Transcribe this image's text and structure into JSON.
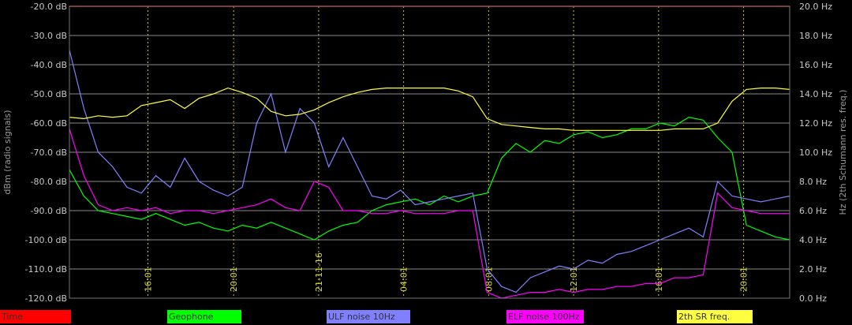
{
  "chart_data": {
    "type": "line",
    "title": "",
    "ylabel_left": "dBm (radio signals)",
    "ylabel_right": "Hz (2th Schumann res. freq.)",
    "ylim_left": [
      -120,
      -20
    ],
    "ylim_right": [
      0,
      20
    ],
    "grid": true,
    "legend_position": "bottom",
    "y_ticks_left": [
      "-20.0 dB",
      "-30.0 dB",
      "-40.0 dB",
      "-50.0 dB",
      "-60.0 dB",
      "-70.0 dB",
      "-80.0 dB",
      "-90.0 dB",
      "-100.0 dB",
      "-110.0 dB",
      "-120.0 dB"
    ],
    "y_ticks_right": [
      "20.0 Hz",
      "18.0 Hz",
      "16.0 Hz",
      "14.0 Hz",
      "12.0 Hz",
      "10.0 Hz",
      "8.0 Hz",
      "6.0 Hz",
      "4.0 Hz",
      "2.0 Hz",
      "0.0 Hz"
    ],
    "x_ticks": [
      "16:01",
      "20:01",
      "21-11-16",
      "04:01",
      "08:01",
      "12:01",
      "16:01",
      "20:01"
    ],
    "x_index_range": [
      0,
      100
    ],
    "x_tick_positions": [
      10.9,
      22.8,
      34.6,
      46.4,
      58.2,
      70.0,
      81.8,
      93.6
    ],
    "series": [
      {
        "name": "Geophone",
        "color": "#00ff00",
        "axis": "left",
        "x": [
          0,
          2,
          4,
          6,
          8,
          10,
          12,
          14,
          16,
          18,
          20,
          22,
          24,
          26,
          28,
          30,
          32,
          34,
          36,
          38,
          40,
          42,
          44,
          46,
          48,
          50,
          52,
          54,
          56,
          58,
          60,
          62,
          64,
          66,
          68,
          70,
          72,
          74,
          76,
          78,
          80,
          82,
          84,
          86,
          88,
          90,
          92,
          94,
          96,
          98,
          100
        ],
        "y": [
          -76,
          -85,
          -90,
          -91,
          -92,
          -93,
          -91,
          -93,
          -95,
          -94,
          -96,
          -97,
          -95,
          -96,
          -94,
          -96,
          -98,
          -100,
          -97,
          -95,
          -94,
          -90,
          -88,
          -87,
          -86,
          -88,
          -85,
          -87,
          -85,
          -84,
          -72,
          -67,
          -70,
          -66,
          -67,
          -64,
          -63,
          -65,
          -64,
          -62,
          -62,
          -60,
          -61,
          -58,
          -59,
          -65,
          -70,
          -95,
          -97,
          -99,
          -100
        ]
      },
      {
        "name": "ULF noise 10Hz",
        "color": "#8080ff",
        "axis": "left",
        "x": [
          0,
          2,
          4,
          6,
          8,
          10,
          12,
          14,
          16,
          18,
          20,
          22,
          24,
          26,
          28,
          30,
          32,
          34,
          36,
          38,
          40,
          42,
          44,
          46,
          48,
          50,
          52,
          54,
          56,
          58,
          60,
          62,
          64,
          66,
          68,
          70,
          72,
          74,
          76,
          78,
          80,
          82,
          84,
          86,
          88,
          90,
          92,
          94,
          96,
          98,
          100
        ],
        "y": [
          -35,
          -55,
          -70,
          -75,
          -82,
          -84,
          -78,
          -82,
          -72,
          -80,
          -83,
          -85,
          -82,
          -60,
          -50,
          -70,
          -55,
          -60,
          -75,
          -65,
          -75,
          -85,
          -86,
          -83,
          -88,
          -87,
          -86,
          -85,
          -84,
          -110,
          -116,
          -118,
          -113,
          -111,
          -109,
          -110,
          -107,
          -108,
          -105,
          -104,
          -102,
          -100,
          -98,
          -96,
          -99,
          -80,
          -85,
          -86,
          -87,
          -86,
          -85
        ]
      },
      {
        "name": "ELF noise 100Hz",
        "color": "#ff00ff",
        "axis": "left",
        "x": [
          0,
          2,
          4,
          6,
          8,
          10,
          12,
          14,
          16,
          18,
          20,
          22,
          24,
          26,
          28,
          30,
          32,
          34,
          36,
          38,
          40,
          42,
          44,
          46,
          48,
          50,
          52,
          54,
          56,
          58,
          60,
          62,
          64,
          66,
          68,
          70,
          72,
          74,
          76,
          78,
          80,
          82,
          84,
          86,
          88,
          90,
          92,
          94,
          96,
          98,
          100
        ],
        "y": [
          -62,
          -78,
          -88,
          -90,
          -89,
          -90,
          -89,
          -91,
          -90,
          -90,
          -91,
          -90,
          -89,
          -88,
          -86,
          -89,
          -90,
          -80,
          -82,
          -90,
          -90,
          -91,
          -91,
          -90,
          -91,
          -91,
          -91,
          -90,
          -90,
          -118,
          -120,
          -119,
          -118,
          -118,
          -117,
          -118,
          -117,
          -117,
          -116,
          -116,
          -115,
          -115,
          -113,
          -113,
          -112,
          -84,
          -89,
          -90,
          -91,
          -91,
          -91
        ]
      },
      {
        "name": "2th SR freq.",
        "color": "#ffff40",
        "axis": "right",
        "x": [
          0,
          2,
          4,
          6,
          8,
          10,
          12,
          14,
          16,
          18,
          20,
          22,
          24,
          26,
          28,
          30,
          32,
          34,
          36,
          38,
          40,
          42,
          44,
          46,
          48,
          50,
          52,
          54,
          56,
          58,
          60,
          62,
          64,
          66,
          68,
          70,
          72,
          74,
          76,
          78,
          80,
          82,
          84,
          86,
          88,
          90,
          92,
          94,
          96,
          98,
          100
        ],
        "y": [
          12.4,
          12.3,
          12.5,
          12.4,
          12.5,
          13.2,
          13.4,
          13.6,
          13.0,
          13.7,
          14.0,
          14.4,
          14.1,
          13.7,
          12.8,
          12.5,
          12.6,
          12.9,
          13.4,
          13.8,
          14.1,
          14.3,
          14.4,
          14.4,
          14.4,
          14.4,
          14.4,
          14.2,
          13.8,
          12.3,
          11.9,
          11.8,
          11.7,
          11.6,
          11.6,
          11.5,
          11.5,
          11.5,
          11.5,
          11.5,
          11.5,
          11.5,
          11.6,
          11.6,
          11.6,
          12.0,
          13.5,
          14.3,
          14.4,
          14.4,
          14.3
        ]
      },
      {
        "name": "Time",
        "color": "#ff0000",
        "axis": "left",
        "x": [
          0,
          100
        ],
        "y": [
          -20,
          -20
        ]
      }
    ]
  }
}
